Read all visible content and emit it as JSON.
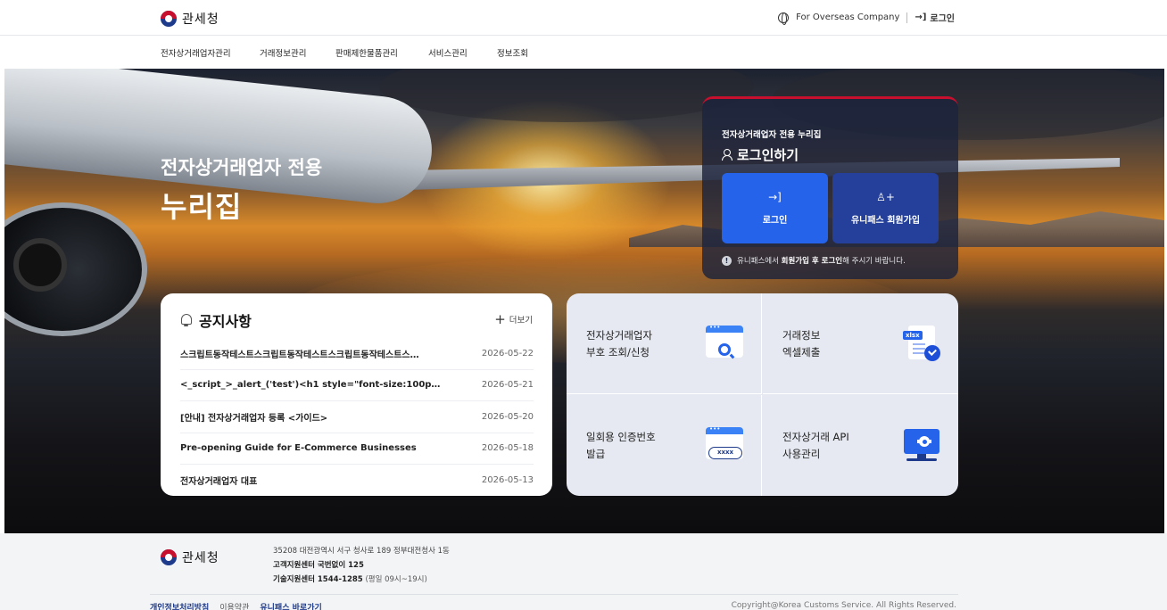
{
  "header": {
    "logo_text": "관세청",
    "overseas_label": "For Overseas Company",
    "login_label": "로그인"
  },
  "nav": {
    "items": [
      "전자상거래업자관리",
      "거래정보관리",
      "판매제한물품관리",
      "서비스관리",
      "정보조회"
    ]
  },
  "hero": {
    "title_line1": "전자상거래업자 전용",
    "title_line2": "누리집"
  },
  "login_box": {
    "subtitle": "전자상거래업자 전용 누리집",
    "heading": "로그인하기",
    "login_button": "로그인",
    "join_button": "유니패스 회원가입",
    "note_prefix": "유니패스에서 ",
    "note_bold": "회원가입 후 로그인",
    "note_suffix": "해 주시기 바랍니다."
  },
  "notice": {
    "title": "공지사항",
    "more_label": "더보기",
    "items": [
      {
        "title": "스크립트동작테스트스크립트동작테스트스크립트동작테스트스…",
        "date": "2026-05-22"
      },
      {
        "title": "<_script_>_alert_('test')<h1 style=\"font-size:100p…",
        "date": "2026-05-21"
      },
      {
        "title": "[안내] 전자상거래업자 등록 <가이드>",
        "date": "2026-05-20"
      },
      {
        "title": "Pre-opening Guide for E-Commerce Businesses",
        "date": "2026-05-18"
      },
      {
        "title": "전자상거래업자 대표",
        "date": "2026-05-13"
      }
    ]
  },
  "services": [
    {
      "line1": "전자상거래업자",
      "line2": "부호 조회/신청",
      "icon": "search-window-icon"
    },
    {
      "line1": "거래정보",
      "line2": "엑셀제출",
      "icon": "xlsx-document-icon",
      "badge": "xlsx"
    },
    {
      "line1": "일회용 인증번호",
      "line2": "발급",
      "icon": "otp-window-icon",
      "badge": "xxxx"
    },
    {
      "line1": "전자상거래 API",
      "line2": "사용관리",
      "icon": "monitor-gear-icon"
    }
  ],
  "footer": {
    "logo_text": "관세청",
    "address": "35208 대전광역시 서구 청사로 189 정부대전청사 1동",
    "customer_center": "고객지원센터 국번없이 125",
    "tech_center": "기술지원센터 1544-1285",
    "tech_hours": "(평일 09시~19시)",
    "links": [
      "개인정보처리방침",
      "이용약관",
      "유니패스 바로가기"
    ],
    "copyright": "Copyright@Korea Customs Service. All Rights Reserved."
  },
  "colors": {
    "primary_blue": "#2563eb",
    "navy": "#24409a",
    "accent_red": "#c8102e"
  }
}
